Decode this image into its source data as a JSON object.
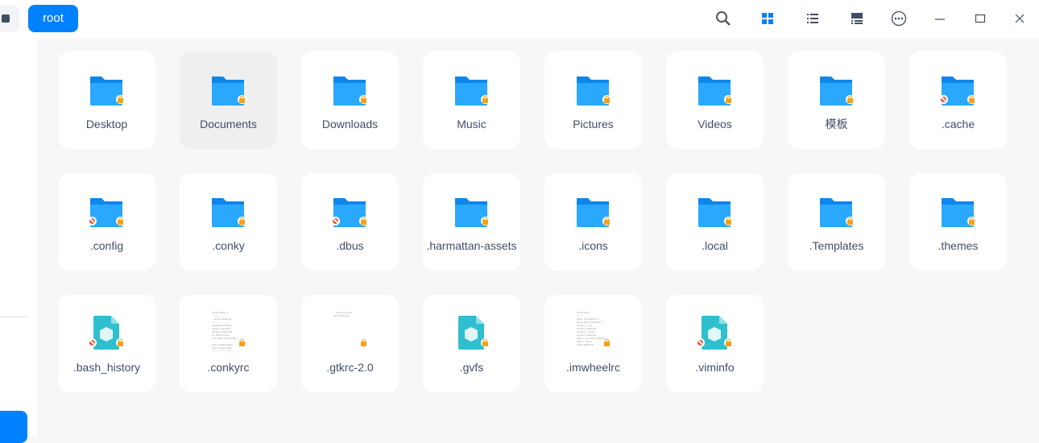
{
  "toolbar": {
    "breadcrumb": "root",
    "icons": [
      "search-icon",
      "icon-view-icon",
      "list-view-icon",
      "tree-view-icon",
      "more-icon",
      "minimize-icon",
      "maximize-icon",
      "close-icon"
    ]
  },
  "colors": {
    "accent": "#0081ff",
    "folder": "#1a9bfc",
    "lock": "#f6a01a",
    "noentry": "#e8533a",
    "file": "#2fbfcf"
  },
  "items": [
    {
      "name": "Desktop",
      "type": "folder",
      "noaccess": false
    },
    {
      "name": "Documents",
      "type": "folder",
      "noaccess": false,
      "selected": true
    },
    {
      "name": "Downloads",
      "type": "folder",
      "noaccess": false
    },
    {
      "name": "Music",
      "type": "folder",
      "noaccess": false
    },
    {
      "name": "Pictures",
      "type": "folder",
      "noaccess": false
    },
    {
      "name": "Videos",
      "type": "folder",
      "noaccess": false
    },
    {
      "name": "模板",
      "type": "folder",
      "noaccess": false
    },
    {
      "name": ".cache",
      "type": "folder",
      "noaccess": true
    },
    {
      "name": ".config",
      "type": "folder",
      "noaccess": true
    },
    {
      "name": ".conky",
      "type": "folder",
      "noaccess": false
    },
    {
      "name": ".dbus",
      "type": "folder",
      "noaccess": true
    },
    {
      "name": ".harmattan-assets",
      "type": "folder",
      "noaccess": false
    },
    {
      "name": ".icons",
      "type": "folder",
      "noaccess": false
    },
    {
      "name": ".local",
      "type": "folder",
      "noaccess": false
    },
    {
      "name": ".Templates",
      "type": "folder",
      "noaccess": false
    },
    {
      "name": ".themes",
      "type": "folder",
      "noaccess": false
    },
    {
      "name": ".bash_history",
      "type": "file",
      "noaccess": true
    },
    {
      "name": ".conkyrc",
      "type": "text",
      "noaccess": false
    },
    {
      "name": ".gtkrc-2.0",
      "type": "text",
      "noaccess": false
    },
    {
      "name": ".gvfs",
      "type": "file",
      "noaccess": false
    },
    {
      "name": ".imwheelrc",
      "type": "text",
      "noaccess": false
    },
    {
      "name": ".viminfo",
      "type": "file",
      "noaccess": true
    }
  ]
}
